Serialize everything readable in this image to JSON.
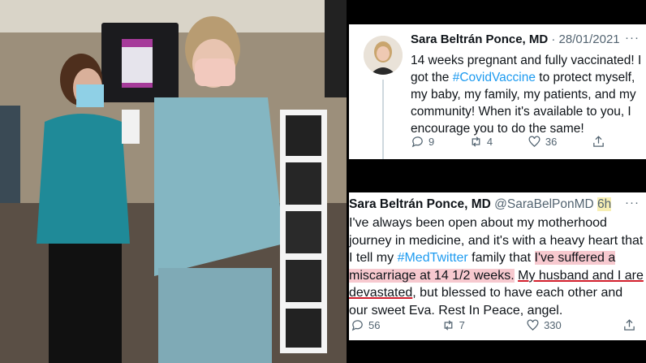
{
  "photo": {
    "alt_icon": "vaccination-photo"
  },
  "tweet1": {
    "name": "Sara Beltrán Ponce, MD",
    "date": "· 28/01/2021",
    "more": "···",
    "text_a": "14 weeks pregnant and fully vaccinated! I got the ",
    "hashtag": "#CovidVaccine",
    "text_b": " to protect myself, my baby, my family, my patients, and my community! When it's available to you, I encourage you to do the same!",
    "replies": "9",
    "retweets": "4",
    "likes": "36"
  },
  "tweet2": {
    "name": "Sara Beltrán Ponce, MD",
    "handle": "@SaraBelPonMD",
    "time": "6h",
    "more": "···",
    "text_a": "I've always been open about my motherhood journey in medicine, and it's with a heavy heart that I tell my ",
    "hashtag": "#MedTwitter",
    "text_b": " family that ",
    "highlight": "I've suffered a miscarriage at 14 1/2 weeks.",
    "text_c": " ",
    "underlined": "My husband and I are devastated",
    "text_d": ", but blessed to have each other and our sweet Eva. Rest In Peace, angel.",
    "replies": "56",
    "retweets": "7",
    "likes": "330"
  },
  "colors": {
    "accent": "#1d9bf0",
    "text": "#0f1419",
    "muted": "#536471",
    "highlight_pink": "#f7c9cf",
    "highlight_yellow": "#f7efb4",
    "underline_red": "#d21f2d"
  }
}
